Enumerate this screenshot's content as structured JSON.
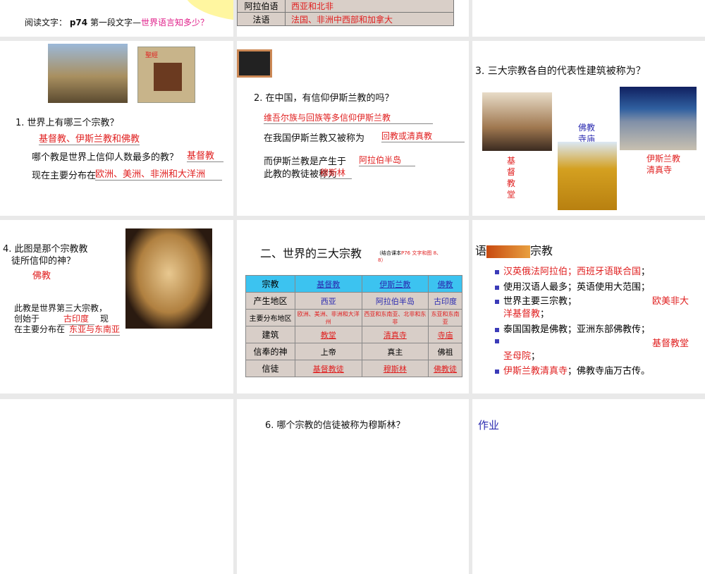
{
  "s1": {
    "prefix": "阅读文字：",
    "page": "p74",
    "mid": "第一段文字—",
    "link": "世界语言知多少？"
  },
  "s2": {
    "rows": [
      {
        "lang": "阿拉伯语",
        "region": "西亚和北非"
      },
      {
        "lang": "法语",
        "region": "法国、非洲中西部和加拿大"
      }
    ]
  },
  "s4": {
    "q": "1. 世界上有哪三个宗教？",
    "a1": "基督教、伊斯兰教和佛教",
    "q2": "哪个教是世界上信仰人数最多的教？",
    "a2": "基督教",
    "q3": "现在主要分布在",
    "a3": "欧洲、美洲、非洲和大洋洲",
    "book_label": "聖經"
  },
  "s5": {
    "q": "2. 在中国，有信仰伊斯兰教的吗？",
    "a1": "维吾尔族与回族等多信仰伊斯兰教",
    "q2": "在我国伊斯兰教又被称为",
    "a2": "回教或清真教",
    "q3": "而伊斯兰教是产生于",
    "a3": "阿拉伯半岛",
    "q4": "此教的教徒被称为",
    "a4": "穆斯林"
  },
  "s6": {
    "q": "3. 三大宗教各自的代表性建筑被称为？",
    "church": "基督教堂",
    "temple": "佛教寺庙",
    "mosque1": "伊斯兰教",
    "mosque2": "清真寺"
  },
  "s7": {
    "q1": "4. 此图是那个宗教教",
    "q2": "徒所信仰的神？",
    "a": "佛教",
    "t1": "此教是世界第三大宗教，",
    "t2": "创始于",
    "a2": "古印度",
    "t3": "现",
    "t4": "在主要分布在",
    "a3": "东亚与东南亚"
  },
  "s8": {
    "title": "二、世界的三大宗教",
    "note1": "（结合课本",
    "note2": "P76 文字和图 8、",
    "note3": "8）",
    "header": [
      "宗教",
      "基督教",
      "伊斯兰教",
      "佛教"
    ],
    "rows": [
      [
        "产生地区",
        "西亚",
        "阿拉伯半岛",
        "古印度"
      ],
      [
        "主要分布地区",
        "欧洲、美洲、非洲和大洋州",
        "西亚和东南亚、北非和东非",
        "东亚和东南亚"
      ],
      [
        "建筑",
        "教堂",
        "清真寺",
        "寺庙"
      ],
      [
        "信奉的神",
        "上帝",
        "真主",
        "佛祖"
      ],
      [
        "信徒",
        "基督教徒",
        "穆斯林",
        "佛教徒"
      ]
    ]
  },
  "s9": {
    "title_a": "语",
    "title_b": "宗教",
    "b1r": "汉英俄法阿拉伯；西班牙语联合国",
    "b1e": "；",
    "b2": "使用汉语人最多；英语使用大范围；",
    "b3": "世界主要三宗教；",
    "b3r": "欧美非大",
    "b3r2": "洋基督教",
    "b3e": "；",
    "b4": "泰国国教是佛教；亚洲东部佛教传；",
    "b5r": "基督教堂",
    "b5r2": "圣母院",
    "b5e": "；",
    "b6r": "伊斯兰教清真寺",
    "b6": "；佛教寺庙万古传。"
  },
  "s11": {
    "q": "6. 哪个宗教的信徒被称为穆斯林？"
  },
  "s12": {
    "title": "作业"
  }
}
